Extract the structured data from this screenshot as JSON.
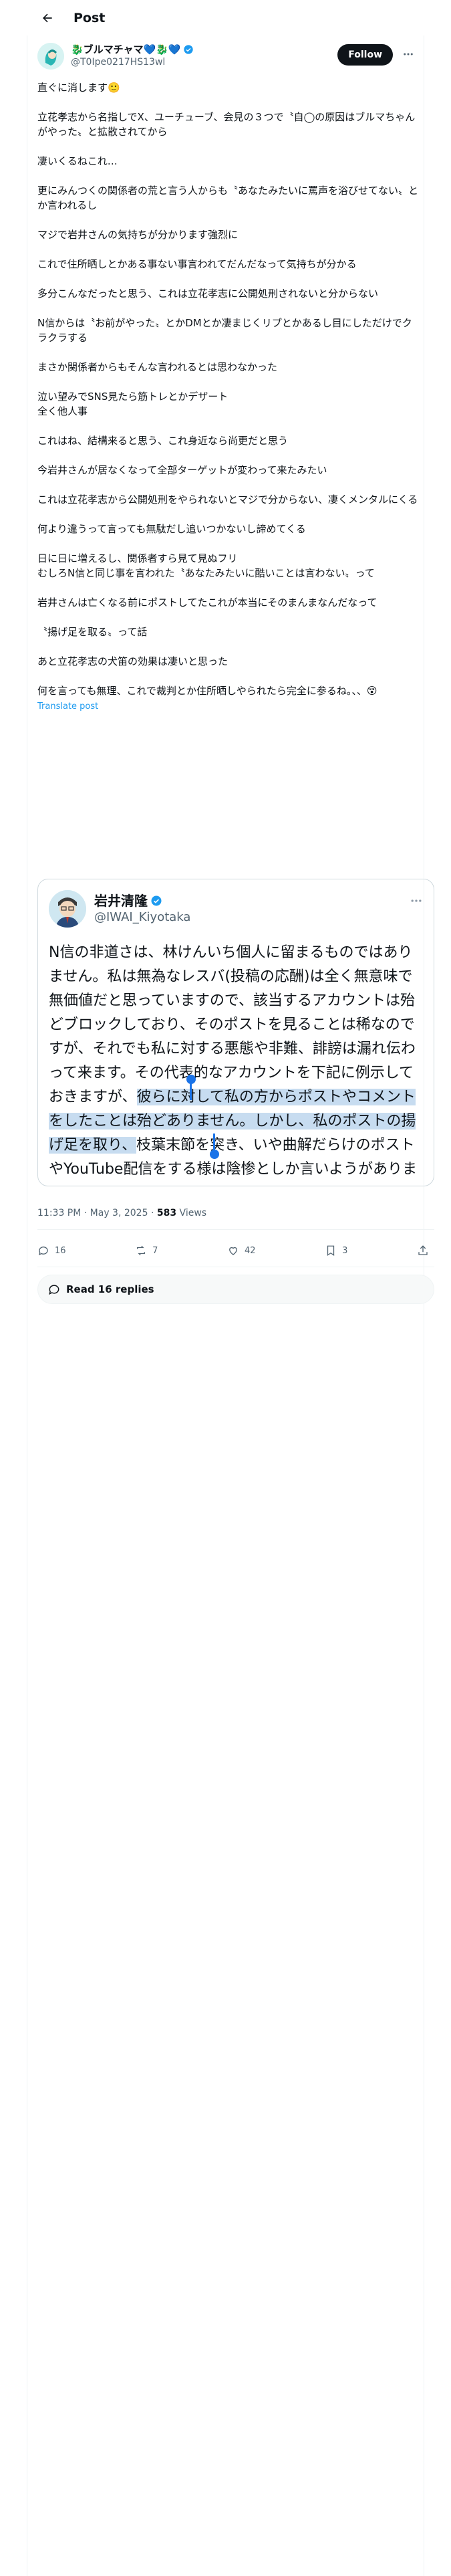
{
  "header": {
    "title": "Post"
  },
  "author": {
    "display_name": "🐉ブルマチャマ💙🐉💙",
    "handle": "@T0Ipe0217HS13wl",
    "follow_label": "Follow"
  },
  "post": {
    "paragraphs": [
      "直ぐに消します🙂",
      "立花孝志から名指しでX、ユーチューブ、会見の３つで〝自◯の原因はブルマちゃんがやった〟と拡散されてから",
      "凄いくるねこれ…",
      "更にみんつくの関係者の荒と言う人からも〝あなたみたいに罵声を浴びせてない〟とか言われるし",
      "マジで岩井さんの気持ちが分かります強烈に",
      "これで住所晒しとかある事ない事言われてだんだなって気持ちが分かる",
      "多分こんなだったと思う、これは立花孝志に公開処刑されないと分からない",
      "N信からは〝お前がやった〟とかDMとか凄まじくリプとかあるし目にしただけでクラクラする",
      "まさか関係者からもそんな言われるとは思わなかった",
      "泣い望みでSNS見たら筋トレとかデザート\n全く他人事",
      "これはね、結構来ると思う、これ身近なら尚更だと思う",
      "今岩井さんが居なくなって全部ターゲットが変わって来たみたい",
      "これは立花孝志から公開処刑をやられないとマジで分からない、凄くメンタルにくる",
      "何より違うって言っても無駄だし追いつかないし諦めてくる",
      "日に日に増えるし、関係者すら見て見ぬフリ\nむしろN信と同じ事を言われた〝あなたみたいに酷いことは言わない〟って",
      "岩井さんは亡くなる前にポストしてたこれが本当にそのまんまなんだなって",
      "〝揚げ足を取る〟って話",
      "あと立花孝志の犬笛の効果は凄いと思った",
      "何を言っても無理、これで裁判とか住所晒しやられたら完全に参るね。、、😵"
    ],
    "translate_label": "Translate post",
    "time": "11:33 PM · May 3, 2025",
    "views_count": "583",
    "views_label": "Views"
  },
  "quote": {
    "display_name": "岩井清隆",
    "handle": "@IWAI_Kiyotaka",
    "text_before": "N信の非道さは、林けんいち個人に留まるものではありません。私は無為なレスバ(投稿の応酬)は全く無意味で無価値だと思っていますので、該当するアカウントは殆どブロックしており、そのポストを見ることは稀なのですが、それでも私に対する悪態や非難、誹謗は漏れ伝わって来ます。その代表的なアカウントを下記に例示しておきますが、",
    "text_highlight": "彼らに対して私の方からポストやコメントをしたことは殆どありません。しかし、私のポストの揚げ足を取り、",
    "text_after": "枝葉末節を突き、いや曲解だらけのポストやYouTube配信をする様は陰惨としか言いようがありません。"
  },
  "actions": {
    "replies": "16",
    "reposts": "7",
    "likes": "42",
    "bookmarks": "3"
  },
  "read_replies_label": "Read 16 replies"
}
